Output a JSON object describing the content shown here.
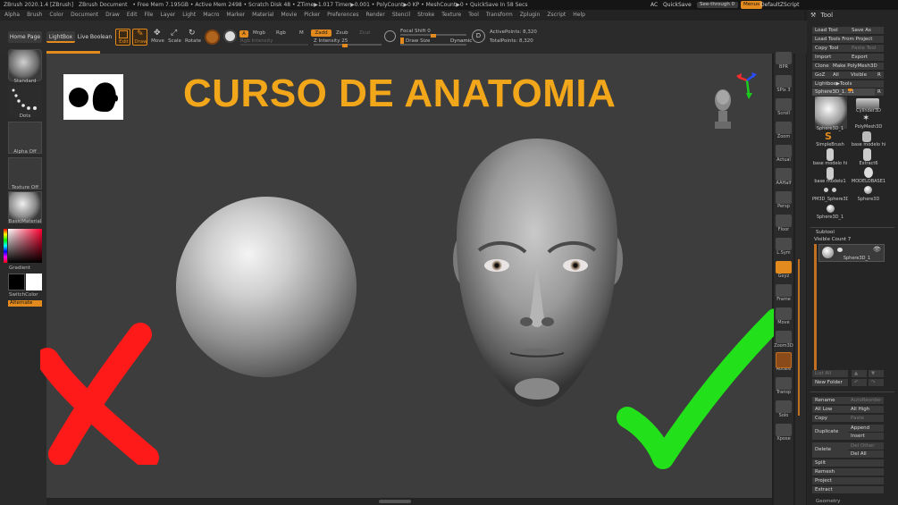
{
  "titlebar": {
    "app": "ZBrush 2020.1.4 [ZBrush]",
    "doc": "ZBrush Document",
    "stats": "• Free Mem 7.195GB • Active Mem 2498 • Scratch Disk 48 • ZTime▶1.017 Timer▶0.001 • PolyCount▶0 KP • MeshCount▶0 • QuickSave In 58 Secs"
  },
  "topright": {
    "ac": "AC",
    "quicksave": "QuickSave",
    "seethrough": "See-through",
    "seethrough_value": "0",
    "menus": "Menus",
    "script": "DefaultZScript"
  },
  "menubar": [
    "Alpha",
    "Brush",
    "Color",
    "Document",
    "Draw",
    "Edit",
    "File",
    "Layer",
    "Light",
    "Macro",
    "Marker",
    "Material",
    "Movie",
    "Picker",
    "Preferences",
    "Render",
    "Stencil",
    "Stroke",
    "Texture",
    "Tool",
    "Transform",
    "Zplugin",
    "Zscript",
    "Help"
  ],
  "toolbar": {
    "home_page": "Home Page",
    "lightbox": "LightBox",
    "live_boolean": "Live Boolean",
    "edit": "Edit",
    "draw": "Draw",
    "move": "Move",
    "scale": "Scale",
    "rotate": "Rotate",
    "a_label": "A",
    "mrgb": "Mrgb",
    "rgb": "Rgb",
    "m": "M",
    "zadd": "Zadd",
    "zsub": "Zsub",
    "zcut": "Zcut",
    "rgb_intensity": "Rgb Intensity",
    "z_intensity": "Z Intensity 25",
    "focal_shift": "Focal Shift 0",
    "draw_size": "Draw Size",
    "draw_size_value": "1",
    "dynamic": "Dynamic",
    "active_points": "ActivePoints: 8,320",
    "total_points": "TotalPoints: 8,320"
  },
  "leftshelf": {
    "standard": "Standard",
    "dots": "Dots",
    "alpha_off": "Alpha Off",
    "texture_off": "Texture Off",
    "material": "BasicMaterial",
    "gradient": "Gradient",
    "switchcolor": "SwitchColor",
    "alternate": "Alternate"
  },
  "canvas": {
    "headline": "CURSO DE ANATOMIA"
  },
  "rightshelf": [
    "BPR",
    "SPix 3",
    "Scroll",
    "Zoom",
    "Actual",
    "AAHalf",
    "Persp",
    "Floor",
    "L.Sym",
    "Gxyz",
    "Frame",
    "Move",
    "Zoom3D",
    "Rotate",
    "Transp",
    "Solo",
    "Xpose"
  ],
  "toolpanel": {
    "title": "Tool",
    "load_tool": "Load Tool",
    "save_as": "Save As",
    "load_from_project": "Load Tools From Project",
    "copy_tool": "Copy Tool",
    "paste_tool": "Paste Tool",
    "import": "Import",
    "export": "Export",
    "clone": "Clone",
    "make_polymesh": "Make PolyMesh3D",
    "goz": "GoZ",
    "all": "All",
    "visible": "Visible",
    "r": "R",
    "lightbox_tools": "Lightbox▶Tools",
    "current_tool": "Sphere3D_1. 31",
    "tools": [
      {
        "label": "Sphere3D_1"
      },
      {
        "label": "Cylinder3D"
      },
      {
        "label": "PolyMesh3D"
      },
      {
        "label": "SimpleBrush"
      },
      {
        "label": "base modelo hi"
      },
      {
        "label": "base modelo hi"
      },
      {
        "label": "Extract6"
      },
      {
        "label": "base modelo1"
      },
      {
        "label": "MODELOBASE1"
      },
      {
        "label": "PM3D_Sphere3D"
      },
      {
        "label": "Sphere3D"
      },
      {
        "label": "Sphere3D_1"
      }
    ],
    "subtool": "Subtool",
    "visible_count": "Visible Count 7",
    "subtool_name": "Sphere3D_1",
    "list_all": "List All",
    "new_folder": "New Folder",
    "rename": "Rename",
    "autoreorder": "AutoReorder",
    "all_low": "All Low",
    "all_high": "All High",
    "copy": "Copy",
    "paste": "Paste",
    "duplicate": "Duplicate",
    "append": "Append",
    "insert": "Insert",
    "delete": "Delete",
    "del_other": "Del Other",
    "del_all": "Del All",
    "split": "Split",
    "remesh": "Remesh",
    "project": "Project",
    "extract": "Extract",
    "geometry": "Geometry"
  },
  "colors": {
    "accent": "#e38a1e",
    "headline": "#f2a61a",
    "cross": "#ff1a1a",
    "check": "#22e01a"
  }
}
